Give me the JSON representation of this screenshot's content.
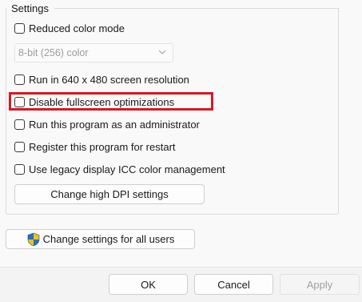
{
  "settings_group": {
    "title": "Settings",
    "options": [
      {
        "key": "reduced_color",
        "label": "Reduced color mode",
        "checked": false
      },
      {
        "key": "run_640",
        "label": "Run in 640 x 480 screen resolution",
        "checked": false
      },
      {
        "key": "disable_fullscreen",
        "label": "Disable fullscreen optimizations",
        "checked": false
      },
      {
        "key": "run_admin",
        "label": "Run this program as an administrator",
        "checked": false
      },
      {
        "key": "register_restart",
        "label": "Register this program for restart",
        "checked": false
      },
      {
        "key": "legacy_icc",
        "label": "Use legacy display ICC color management",
        "checked": false
      }
    ],
    "color_select": {
      "value": "8-bit (256) color",
      "disabled": true
    },
    "high_dpi_button": "Change high DPI settings"
  },
  "all_users_button": {
    "label": "Change settings for all users",
    "icon": "uac-shield-icon"
  },
  "footer": {
    "ok_label": "OK",
    "cancel_label": "Cancel",
    "apply_label": "Apply",
    "apply_disabled": true
  },
  "highlight": {
    "target": "disable_fullscreen",
    "color": "#d71920"
  },
  "colors": {
    "background": "#f9f9f9",
    "footer_background": "#f3f3f3",
    "shield_blue": "#1f6fd1",
    "shield_yellow": "#f2c200"
  }
}
